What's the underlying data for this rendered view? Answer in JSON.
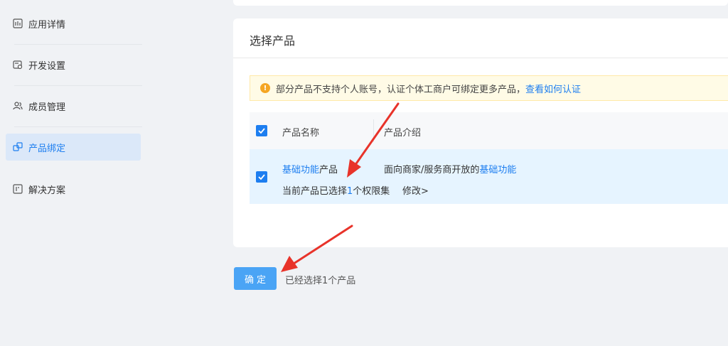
{
  "sidebar": {
    "items": [
      {
        "label": "应用详情",
        "icon": "app-detail-icon"
      },
      {
        "label": "开发设置",
        "icon": "dev-settings-icon"
      },
      {
        "label": "成员管理",
        "icon": "members-icon"
      },
      {
        "label": "产品绑定",
        "icon": "product-bind-icon",
        "active": true
      },
      {
        "label": "解决方案",
        "icon": "solution-icon"
      }
    ]
  },
  "card": {
    "title": "选择产品",
    "notice": {
      "text": "部分产品不支持个人账号，认证个体工商户可绑定更多产品，",
      "link": "查看如何认证"
    },
    "table": {
      "headers": [
        "产品名称",
        "产品介绍"
      ],
      "row": {
        "name_link": "基础功能",
        "name_rest": "产品",
        "desc_prefix": "面向商家/服务商开放的",
        "desc_link": "基础功能",
        "perm_prefix": "当前产品已选择",
        "perm_count": "1",
        "perm_suffix": "个权限集",
        "modify": "修改>"
      }
    }
  },
  "footer": {
    "confirm": "确定",
    "selected_text": "已经选择1个产品"
  },
  "colors": {
    "accent": "#1d7ef0",
    "row_bg": "#e6f4ff",
    "arrow": "#e8332a"
  }
}
